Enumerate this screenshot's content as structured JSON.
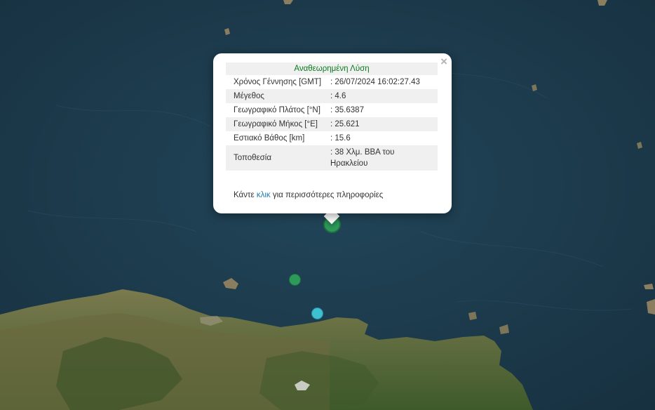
{
  "popup": {
    "title": "Αναθεωρημένη Λύση",
    "rows": [
      {
        "label": "Χρόνος Γέννησης [GMT]",
        "value": ": 26/07/2024 16:02:27.43"
      },
      {
        "label": "Μέγεθος",
        "value": ": 4.6"
      },
      {
        "label": "Γεωγραφικό Πλάτος [°N]",
        "value": ": 35.6387"
      },
      {
        "label": "Γεωγραφικό Μήκος [°E]",
        "value": ": 25.621"
      },
      {
        "label": "Εστιακό Βάθος [km]",
        "value": ": 15.6"
      },
      {
        "label": "Τοποθεσία",
        "value": ": 38 Χλμ. ΒΒΑ του Ηρακλείου"
      }
    ],
    "more_prefix": "Κάντε",
    "more_link": "κλικ",
    "more_suffix": "για περισσότερες πληροφορίες",
    "close_glyph": "×"
  },
  "markers": [
    {
      "id": "main",
      "color": "#2e9a5a",
      "magnitude": 4.6
    },
    {
      "id": "small",
      "color": "#2e9a5a"
    },
    {
      "id": "cyan",
      "color": "#3ec0d0"
    }
  ],
  "colors": {
    "sea": "#1d3a4c",
    "land": "#5e6a3c",
    "land_dark": "#3f5a2c",
    "title_green": "#0a7a1c",
    "link": "#1f7fb0"
  }
}
